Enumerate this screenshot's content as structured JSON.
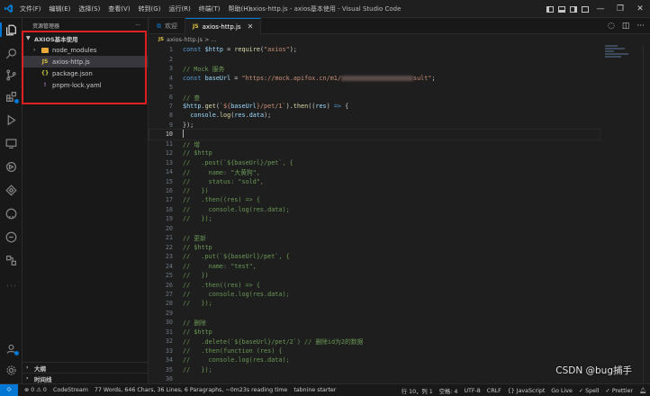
{
  "window": {
    "title": "axios-http.js - axios基本使用 - Visual Studio Code",
    "menus": [
      "文件(F)",
      "编辑(E)",
      "选择(S)",
      "查看(V)",
      "转到(G)",
      "运行(R)",
      "终端(T)",
      "帮助(H)"
    ],
    "controls": [
      "—",
      "❐",
      "✕"
    ]
  },
  "sidebar": {
    "header": "资源管理器",
    "more": "···",
    "section_title": "AXIOS基本使用",
    "items": [
      {
        "label": "node_modules",
        "type": "folder"
      },
      {
        "label": "axios-http.js",
        "type": "js",
        "selected": true
      },
      {
        "label": "package.json",
        "type": "json"
      },
      {
        "label": "pnpm-lock.yaml",
        "type": "yaml"
      }
    ],
    "outline": "大纲",
    "timeline": "时间线"
  },
  "tabs": [
    {
      "label": "欢迎",
      "icon": "vscode-icon",
      "active": false
    },
    {
      "label": "axios-http.js",
      "icon": "js-icon",
      "active": true,
      "close": "✕"
    }
  ],
  "breadcrumb": "axios-http.js > ...",
  "editor": {
    "current_line": 10,
    "lines": [
      {
        "n": 1,
        "parts": [
          [
            "kw",
            "const "
          ],
          [
            "var",
            "$http"
          ],
          [
            "code",
            " = "
          ],
          [
            "fn",
            "require"
          ],
          [
            "code",
            "("
          ],
          [
            "str",
            "\"axios\""
          ],
          [
            "code",
            ");"
          ]
        ]
      },
      {
        "n": 2,
        "parts": []
      },
      {
        "n": 3,
        "parts": [
          [
            "cm",
            "// Mock 服务"
          ]
        ]
      },
      {
        "n": 4,
        "parts": [
          [
            "kw",
            "const "
          ],
          [
            "var",
            "baseUrl"
          ],
          [
            "code",
            " = "
          ],
          [
            "str",
            "\"https://mock.apifox.cn/m1/"
          ],
          [
            "blur",
            ""
          ],
          [
            "str",
            "sult\""
          ],
          [
            "code",
            ";"
          ]
        ]
      },
      {
        "n": 5,
        "parts": []
      },
      {
        "n": 6,
        "parts": [
          [
            "cm",
            "// 查"
          ]
        ]
      },
      {
        "n": 7,
        "parts": [
          [
            "var",
            "$http"
          ],
          [
            "code",
            "."
          ],
          [
            "fn",
            "get"
          ],
          [
            "code",
            "("
          ],
          [
            "str",
            "`${"
          ],
          [
            "var",
            "baseUrl"
          ],
          [
            "str",
            "}/pet/1`"
          ],
          [
            "code",
            ")."
          ],
          [
            "fn",
            "then"
          ],
          [
            "code",
            "(("
          ],
          [
            "var",
            "res"
          ],
          [
            "code",
            ") "
          ],
          [
            "kw",
            "=>"
          ],
          [
            "code",
            " {"
          ]
        ]
      },
      {
        "n": 8,
        "parts": [
          [
            "code",
            "  "
          ],
          [
            "var",
            "console"
          ],
          [
            "code",
            "."
          ],
          [
            "fn",
            "log"
          ],
          [
            "code",
            "("
          ],
          [
            "var",
            "res"
          ],
          [
            "code",
            "."
          ],
          [
            "var",
            "data"
          ],
          [
            "code",
            ");"
          ]
        ]
      },
      {
        "n": 9,
        "parts": [
          [
            "code",
            "});"
          ]
        ]
      },
      {
        "n": 10,
        "parts": [
          [
            "caret",
            ""
          ]
        ]
      },
      {
        "n": 11,
        "parts": [
          [
            "cm",
            "// 增"
          ]
        ]
      },
      {
        "n": 12,
        "parts": [
          [
            "cm",
            "// $http"
          ]
        ]
      },
      {
        "n": 13,
        "parts": [
          [
            "cm",
            "//   .post(`${baseUrl}/pet`, {"
          ]
        ]
      },
      {
        "n": 14,
        "parts": [
          [
            "cm",
            "//     name: \"大黄狗\","
          ]
        ]
      },
      {
        "n": 15,
        "parts": [
          [
            "cm",
            "//     status: \"sold\","
          ]
        ]
      },
      {
        "n": 16,
        "parts": [
          [
            "cm",
            "//   })"
          ]
        ]
      },
      {
        "n": 17,
        "parts": [
          [
            "cm",
            "//   .then((res) => {"
          ]
        ]
      },
      {
        "n": 18,
        "parts": [
          [
            "cm",
            "//     console.log(res.data);"
          ]
        ]
      },
      {
        "n": 19,
        "parts": [
          [
            "cm",
            "//   });"
          ]
        ]
      },
      {
        "n": 20,
        "parts": []
      },
      {
        "n": 21,
        "parts": [
          [
            "cm",
            "// 更新"
          ]
        ]
      },
      {
        "n": 22,
        "parts": [
          [
            "cm",
            "// $http"
          ]
        ]
      },
      {
        "n": 23,
        "parts": [
          [
            "cm",
            "//   .put(`${baseUrl}/pet`, {"
          ]
        ]
      },
      {
        "n": 24,
        "parts": [
          [
            "cm",
            "//     name: \"test\","
          ]
        ]
      },
      {
        "n": 25,
        "parts": [
          [
            "cm",
            "//   })"
          ]
        ]
      },
      {
        "n": 26,
        "parts": [
          [
            "cm",
            "//   .then((res) => {"
          ]
        ]
      },
      {
        "n": 27,
        "parts": [
          [
            "cm",
            "//     console.log(res.data);"
          ]
        ]
      },
      {
        "n": 28,
        "parts": [
          [
            "cm",
            "//   });"
          ]
        ]
      },
      {
        "n": 29,
        "parts": []
      },
      {
        "n": 30,
        "parts": [
          [
            "cm",
            "// 删除"
          ]
        ]
      },
      {
        "n": 31,
        "parts": [
          [
            "cm",
            "// $http"
          ]
        ]
      },
      {
        "n": 32,
        "parts": [
          [
            "cm",
            "//   .delete(`${baseUrl}/pet/2`) // 删除id为2的数据"
          ]
        ]
      },
      {
        "n": 33,
        "parts": [
          [
            "cm",
            "//   .then(function (res) {"
          ]
        ]
      },
      {
        "n": 34,
        "parts": [
          [
            "cm",
            "//     console.log(res.data);"
          ]
        ]
      },
      {
        "n": 35,
        "parts": [
          [
            "cm",
            "//   });"
          ]
        ]
      },
      {
        "n": 36,
        "parts": []
      }
    ]
  },
  "statusbar": {
    "remote": "⟐",
    "problems": "⊗ 0 ⚠ 0",
    "codestream": "CodeStream",
    "wordcount": "77 Words, 646 Chars, 36 Lines, 6 Paragraphs, ~0m23s reading time",
    "tabnine": "tabnine starter",
    "position": "行 10，列 1",
    "spaces": "空格: 4",
    "encoding": "UTF-8",
    "eol": "CRLF",
    "language": "{} JavaScript",
    "golive": "Go Live",
    "spell": "✓ Spell",
    "prettier": "✓ Prettier"
  },
  "watermark": "CSDN @bug捕手"
}
